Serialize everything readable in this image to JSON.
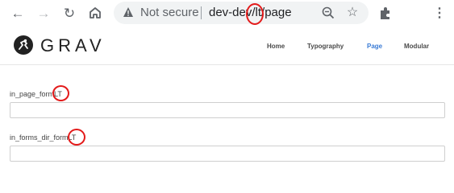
{
  "browser": {
    "not_secure_label": "Not secure",
    "url": "dev-dev/lt/page"
  },
  "site": {
    "logo_text": "GRAV",
    "nav": [
      {
        "label": "Home"
      },
      {
        "label": "Typography"
      },
      {
        "label": "Page"
      },
      {
        "label": "Modular"
      }
    ],
    "active_nav": "Page"
  },
  "form": {
    "fields": [
      {
        "label": "in_page_form",
        "suffix": "LT",
        "value": ""
      },
      {
        "label": "in_forms_dir_form",
        "suffix": "LT",
        "value": ""
      }
    ]
  },
  "colors": {
    "accent": "#3a7bd5",
    "highlight_circle": "#e31a1a"
  }
}
